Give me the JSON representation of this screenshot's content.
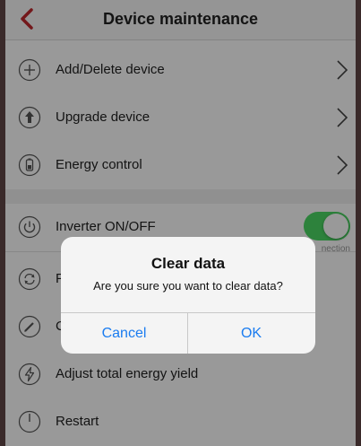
{
  "header": {
    "title": "Device maintenance",
    "back_icon": "chevron-left-icon",
    "accent": "#c0282d"
  },
  "menu": {
    "group1": [
      {
        "label": "Add/Delete device",
        "icon": "plus-circle-icon"
      },
      {
        "label": "Upgrade device",
        "icon": "upload-circle-icon"
      },
      {
        "label": "Energy control",
        "icon": "battery-circle-icon"
      }
    ],
    "group2": [
      {
        "label": "Inverter ON/OFF",
        "icon": "power-circle-icon",
        "toggle_on": true
      },
      {
        "label": "F",
        "icon": "refresh-circle-icon"
      },
      {
        "label": "C",
        "icon": "pen-circle-icon"
      },
      {
        "label": "Adjust total energy yield",
        "icon": "bolt-circle-icon"
      },
      {
        "label": "Restart",
        "icon": "restart-circle-icon"
      }
    ],
    "connection_note": "nection"
  },
  "dialog": {
    "title": "Clear data",
    "message": "Are you sure you want to clear data?",
    "cancel_label": "Cancel",
    "ok_label": "OK",
    "button_color": "#1a7cf0"
  }
}
